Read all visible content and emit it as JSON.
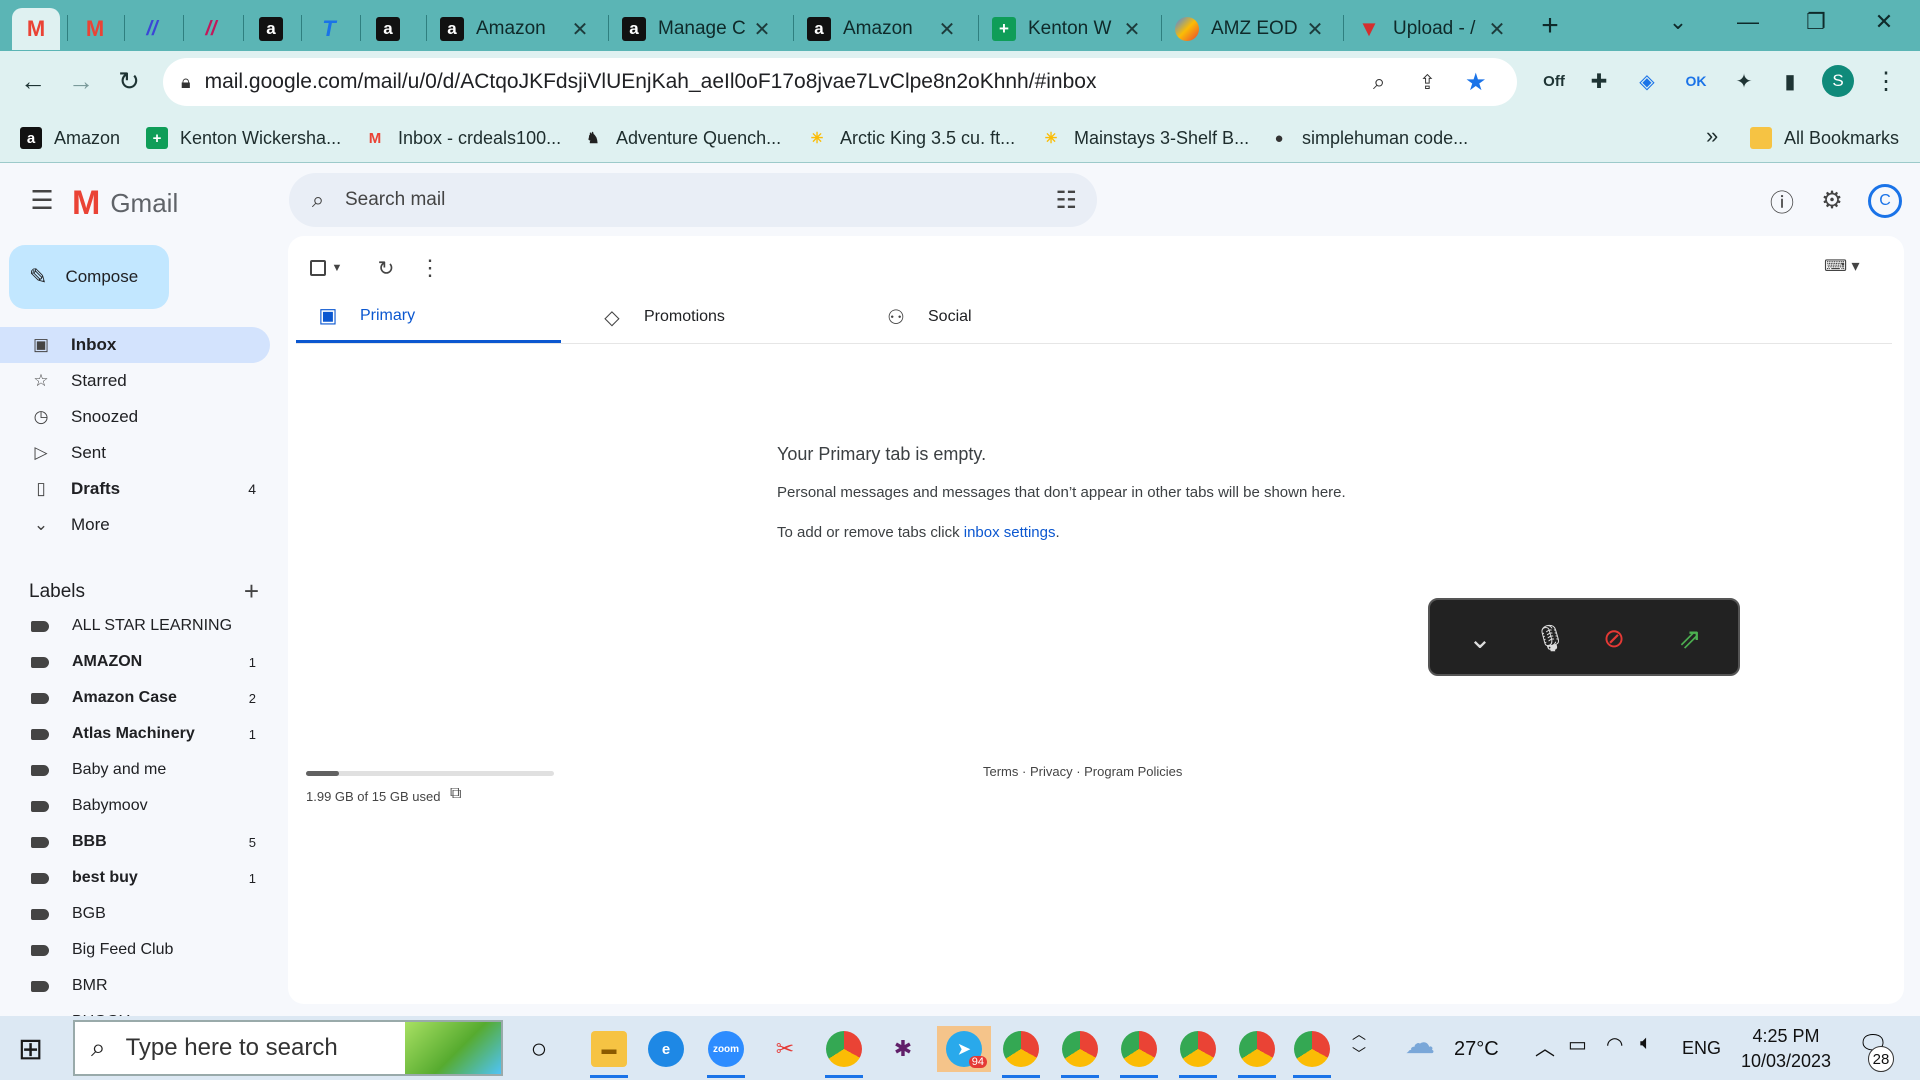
{
  "browser": {
    "pinned_tabs": [
      {
        "name": "gmail-pinned",
        "icon": "gmail-icon",
        "glyph": "M",
        "style": "gm"
      },
      {
        "name": "gmail-pinned-2",
        "icon": "gmail-icon",
        "glyph": "M",
        "style": "gm"
      },
      {
        "name": "pinned-app-1",
        "icon": "app-icon",
        "glyph": "//",
        "style": "m1"
      },
      {
        "name": "pinned-app-2",
        "icon": "app-icon",
        "glyph": "//",
        "style": "m2"
      },
      {
        "name": "amazon-pinned",
        "icon": "amazon-icon",
        "glyph": "a",
        "style": "amz"
      },
      {
        "name": "t-pinned",
        "icon": "t-app-icon",
        "glyph": "T",
        "style": "t"
      },
      {
        "name": "amazon-pinned-2",
        "icon": "amazon-icon",
        "glyph": "a",
        "style": "amz"
      }
    ],
    "tabs": [
      {
        "label": "Amazon",
        "icon": "amazon-icon",
        "glyph": "a",
        "style": "amz"
      },
      {
        "label": "Manage C",
        "icon": "amazon-icon",
        "glyph": "a",
        "style": "amz"
      },
      {
        "label": "Amazon",
        "icon": "amazon-icon",
        "glyph": "a",
        "style": "amz"
      },
      {
        "label": "Kenton W",
        "icon": "sheets-icon",
        "glyph": "+",
        "style": "grn"
      },
      {
        "label": "AMZ EOD",
        "icon": "amz-eod-icon",
        "glyph": "",
        "style": "amzeod"
      },
      {
        "label": "Upload - /",
        "icon": "upload-icon",
        "glyph": "▼",
        "style": "v"
      }
    ],
    "new_tab_label": "+",
    "url": "mail.google.com/mail/u/0/d/ACtqoJKFdsjiVlUEnjKah_aeIl0oF17o8jvae7LvClpe8n2oKhnh/#inbox",
    "profile_initial": "S",
    "bookmarks": [
      {
        "label": "Amazon",
        "icon": "amazon-icon",
        "glyph": "a"
      },
      {
        "label": "Kenton Wickersha...",
        "icon": "sheets-icon",
        "glyph": "+"
      },
      {
        "label": "Inbox - crdeals100...",
        "icon": "gmail-icon",
        "glyph": "M"
      },
      {
        "label": "Adventure Quench...",
        "icon": "horse-icon",
        "glyph": "♞"
      },
      {
        "label": "Arctic King 3.5 cu. ft...",
        "icon": "walmart-icon",
        "glyph": "✳"
      },
      {
        "label": "Mainstays 3-Shelf B...",
        "icon": "walmart-icon",
        "glyph": "✳"
      },
      {
        "label": "simplehuman code...",
        "icon": "globe-icon",
        "glyph": "●"
      }
    ],
    "more_bookmarks": "»",
    "all_bookmarks": "All Bookmarks"
  },
  "gmail": {
    "app_name": "Gmail",
    "search_placeholder": "Search mail",
    "avatar_initial": "C",
    "compose_label": "Compose",
    "nav": [
      {
        "label": "Inbox",
        "icon": "inbox-icon",
        "glyph": "▣",
        "count": "",
        "active": true,
        "bold": true
      },
      {
        "label": "Starred",
        "icon": "star-icon",
        "glyph": "☆",
        "count": "",
        "active": false,
        "bold": false
      },
      {
        "label": "Snoozed",
        "icon": "clock-icon",
        "glyph": "◷",
        "count": "",
        "active": false,
        "bold": false
      },
      {
        "label": "Sent",
        "icon": "send-icon",
        "glyph": "▷",
        "count": "",
        "active": false,
        "bold": false
      },
      {
        "label": "Drafts",
        "icon": "draft-icon",
        "glyph": "▯",
        "count": "4",
        "active": false,
        "bold": true
      },
      {
        "label": "More",
        "icon": "chevron-down-icon",
        "glyph": "⌄",
        "count": "",
        "active": false,
        "bold": false
      }
    ],
    "labels_heading": "Labels",
    "labels": [
      {
        "name": "ALL STAR LEARNING",
        "count": "",
        "bold": false
      },
      {
        "name": "AMAZON",
        "count": "1",
        "bold": true
      },
      {
        "name": "Amazon Case",
        "count": "2",
        "bold": true
      },
      {
        "name": "Atlas Machinery",
        "count": "1",
        "bold": true
      },
      {
        "name": "Baby and me",
        "count": "",
        "bold": false
      },
      {
        "name": "Babymoov",
        "count": "",
        "bold": false
      },
      {
        "name": "BBB",
        "count": "5",
        "bold": true
      },
      {
        "name": "best buy",
        "count": "1",
        "bold": true
      },
      {
        "name": "BGB",
        "count": "",
        "bold": false
      },
      {
        "name": "Big Feed Club",
        "count": "",
        "bold": false
      },
      {
        "name": "BMR",
        "count": "",
        "bold": false
      },
      {
        "name": "BUGGY",
        "count": "",
        "bold": false
      }
    ],
    "tabs": [
      {
        "label": "Primary",
        "icon": "inbox-tab-icon",
        "glyph": "▣",
        "active": true
      },
      {
        "label": "Promotions",
        "icon": "tag-icon",
        "glyph": "◇",
        "active": false
      },
      {
        "label": "Social",
        "icon": "people-icon",
        "glyph": "⚇",
        "active": false
      }
    ],
    "empty_title": "Your Primary tab is empty.",
    "empty_desc": "Personal messages and messages that don’t appear in other tabs will be shown here.",
    "settings_prefix": "To add or remove tabs click ",
    "settings_link": "inbox settings",
    "settings_suffix": ".",
    "storage_text": "1.99 GB of 15 GB used",
    "storage_fraction": 0.133,
    "footer_terms": "Terms",
    "footer_privacy": "Privacy",
    "footer_policies": "Program Policies",
    "footer_sep": " · "
  },
  "taskbar": {
    "search_placeholder": "Type here to search",
    "temperature": "27°C",
    "language": "ENG",
    "time": "4:25 PM",
    "date": "10/03/2023",
    "notification_count": "28",
    "telegram_badge": "94",
    "zoom_label": "zoom"
  }
}
